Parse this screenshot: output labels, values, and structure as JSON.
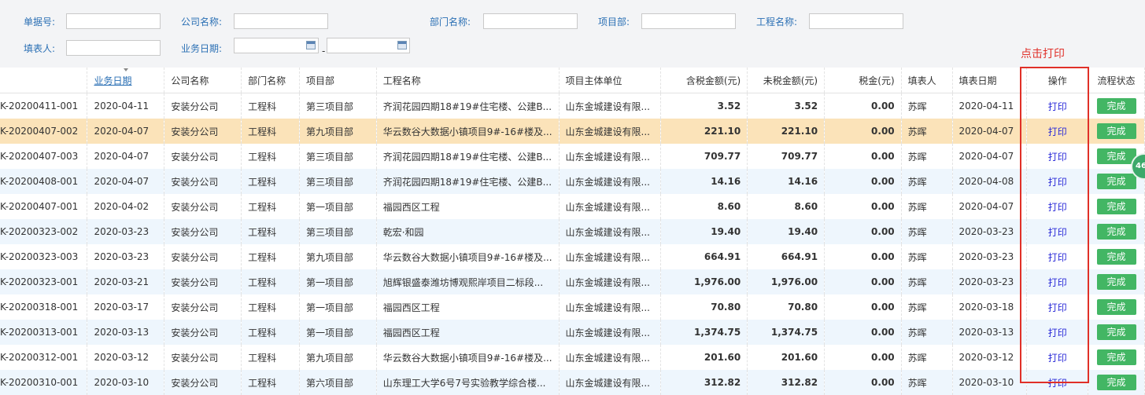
{
  "filters": {
    "order_no_label": "单据号:",
    "company_label": "公司名称:",
    "dept_label": "部门名称:",
    "project_dept_label": "项目部:",
    "project_name_label": "工程名称:",
    "filler_label": "填表人:",
    "biz_date_label": "业务日期:",
    "date_separator": "-"
  },
  "annotation": "点击打印",
  "float_badge": "46",
  "columns": [
    "业务日期",
    "公司名称",
    "部门名称",
    "项目部",
    "工程名称",
    "项目主体单位",
    "含税金额(元)",
    "未税金额(元)",
    "税金(元)",
    "填表人",
    "填表日期",
    "操作",
    "流程状态"
  ],
  "rows": [
    {
      "code": "K-20200411-001",
      "date": "2020-04-11",
      "company": "安装分公司",
      "dept": "工程科",
      "proj_dept": "第三项目部",
      "proj": "齐润花园四期18#19#住宅楼、公建B...",
      "unit": "山东金城建设有限...",
      "tax_incl": "3.52",
      "tax_excl": "3.52",
      "tax": "0.00",
      "filler": "苏晖",
      "fill_date": "2020-04-11",
      "action": "打印",
      "status": "完成"
    },
    {
      "code": "K-20200407-002",
      "date": "2020-04-07",
      "company": "安装分公司",
      "dept": "工程科",
      "proj_dept": "第九项目部",
      "proj": "华云数谷大数据小镇项目9#-16#楼及...",
      "unit": "山东金城建设有限...",
      "tax_incl": "221.10",
      "tax_excl": "221.10",
      "tax": "0.00",
      "filler": "苏晖",
      "fill_date": "2020-04-07",
      "action": "打印",
      "status": "完成"
    },
    {
      "code": "K-20200407-003",
      "date": "2020-04-07",
      "company": "安装分公司",
      "dept": "工程科",
      "proj_dept": "第三项目部",
      "proj": "齐润花园四期18#19#住宅楼、公建B...",
      "unit": "山东金城建设有限...",
      "tax_incl": "709.77",
      "tax_excl": "709.77",
      "tax": "0.00",
      "filler": "苏晖",
      "fill_date": "2020-04-07",
      "action": "打印",
      "status": "完成"
    },
    {
      "code": "K-20200408-001",
      "date": "2020-04-07",
      "company": "安装分公司",
      "dept": "工程科",
      "proj_dept": "第三项目部",
      "proj": "齐润花园四期18#19#住宅楼、公建B...",
      "unit": "山东金城建设有限...",
      "tax_incl": "14.16",
      "tax_excl": "14.16",
      "tax": "0.00",
      "filler": "苏晖",
      "fill_date": "2020-04-08",
      "action": "打印",
      "status": "完成"
    },
    {
      "code": "K-20200407-001",
      "date": "2020-04-02",
      "company": "安装分公司",
      "dept": "工程科",
      "proj_dept": "第一项目部",
      "proj": "福园西区工程",
      "unit": "山东金城建设有限...",
      "tax_incl": "8.60",
      "tax_excl": "8.60",
      "tax": "0.00",
      "filler": "苏晖",
      "fill_date": "2020-04-07",
      "action": "打印",
      "status": "完成"
    },
    {
      "code": "K-20200323-002",
      "date": "2020-03-23",
      "company": "安装分公司",
      "dept": "工程科",
      "proj_dept": "第三项目部",
      "proj": "乾宏·和园",
      "unit": "山东金城建设有限...",
      "tax_incl": "19.40",
      "tax_excl": "19.40",
      "tax": "0.00",
      "filler": "苏晖",
      "fill_date": "2020-03-23",
      "action": "打印",
      "status": "完成"
    },
    {
      "code": "K-20200323-003",
      "date": "2020-03-23",
      "company": "安装分公司",
      "dept": "工程科",
      "proj_dept": "第九项目部",
      "proj": "华云数谷大数据小镇项目9#-16#楼及...",
      "unit": "山东金城建设有限...",
      "tax_incl": "664.91",
      "tax_excl": "664.91",
      "tax": "0.00",
      "filler": "苏晖",
      "fill_date": "2020-03-23",
      "action": "打印",
      "status": "完成"
    },
    {
      "code": "K-20200323-001",
      "date": "2020-03-21",
      "company": "安装分公司",
      "dept": "工程科",
      "proj_dept": "第一项目部",
      "proj": "旭辉银盛泰潍坊博观熙岸项目二标段...",
      "unit": "山东金城建设有限...",
      "tax_incl": "1,976.00",
      "tax_excl": "1,976.00",
      "tax": "0.00",
      "filler": "苏晖",
      "fill_date": "2020-03-23",
      "action": "打印",
      "status": "完成"
    },
    {
      "code": "K-20200318-001",
      "date": "2020-03-17",
      "company": "安装分公司",
      "dept": "工程科",
      "proj_dept": "第一项目部",
      "proj": "福园西区工程",
      "unit": "山东金城建设有限...",
      "tax_incl": "70.80",
      "tax_excl": "70.80",
      "tax": "0.00",
      "filler": "苏晖",
      "fill_date": "2020-03-18",
      "action": "打印",
      "status": "完成"
    },
    {
      "code": "K-20200313-001",
      "date": "2020-03-13",
      "company": "安装分公司",
      "dept": "工程科",
      "proj_dept": "第一项目部",
      "proj": "福园西区工程",
      "unit": "山东金城建设有限...",
      "tax_incl": "1,374.75",
      "tax_excl": "1,374.75",
      "tax": "0.00",
      "filler": "苏晖",
      "fill_date": "2020-03-13",
      "action": "打印",
      "status": "完成"
    },
    {
      "code": "K-20200312-001",
      "date": "2020-03-12",
      "company": "安装分公司",
      "dept": "工程科",
      "proj_dept": "第九项目部",
      "proj": "华云数谷大数据小镇项目9#-16#楼及...",
      "unit": "山东金城建设有限...",
      "tax_incl": "201.60",
      "tax_excl": "201.60",
      "tax": "0.00",
      "filler": "苏晖",
      "fill_date": "2020-03-12",
      "action": "打印",
      "status": "完成"
    },
    {
      "code": "K-20200310-001",
      "date": "2020-03-10",
      "company": "安装分公司",
      "dept": "工程科",
      "proj_dept": "第六项目部",
      "proj": "山东理工大学6号7号实验教学综合楼...",
      "unit": "山东金城建设有限...",
      "tax_incl": "312.82",
      "tax_excl": "312.82",
      "tax": "0.00",
      "filler": "苏晖",
      "fill_date": "2020-03-10",
      "action": "打印",
      "status": "完成"
    }
  ],
  "selected_row": 1,
  "colors": {
    "accent": "#2a6fb4",
    "selected": "#fbe3b9",
    "stripe": "#eef6fd",
    "done": "#43b664",
    "annotation": "#e0312b"
  }
}
